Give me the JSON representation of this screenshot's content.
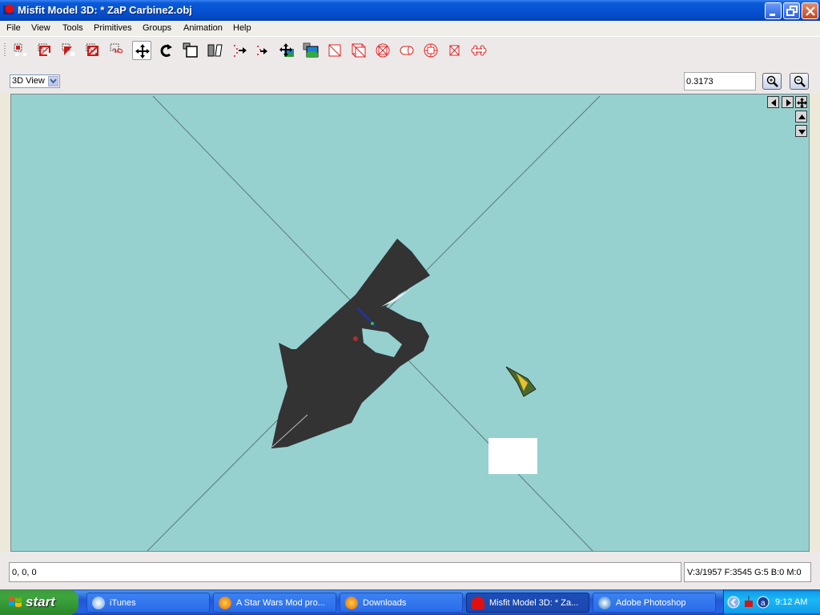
{
  "window": {
    "title": "Misfit Model 3D: * ZaP Carbine2.obj",
    "controls": [
      "minimize",
      "restore",
      "close"
    ]
  },
  "menu": {
    "items": [
      "File",
      "View",
      "Tools",
      "Primitives",
      "Groups",
      "Animation",
      "Help"
    ]
  },
  "toolbar": {
    "tools": [
      {
        "name": "select-vertices-tool",
        "icon": "select-vertices-icon"
      },
      {
        "name": "select-faces-tool",
        "icon": "select-faces-icon"
      },
      {
        "name": "select-connected-tool",
        "icon": "select-connected-icon"
      },
      {
        "name": "select-groups-tool",
        "icon": "select-groups-icon"
      },
      {
        "name": "select-bones-tool",
        "icon": "select-bones-icon"
      },
      {
        "name": "move-tool",
        "icon": "move-icon",
        "active": true
      },
      {
        "name": "rotate-tool",
        "icon": "rotate-icon"
      },
      {
        "name": "scale-tool",
        "icon": "scale-icon"
      },
      {
        "name": "shear-tool",
        "icon": "shear-icon"
      },
      {
        "name": "extrude-tool",
        "icon": "extrude-icon"
      },
      {
        "name": "attract-near-tool",
        "icon": "attract-icon"
      },
      {
        "name": "drag-vertex-tool",
        "icon": "drag-vertex-icon"
      },
      {
        "name": "background-image-tool",
        "icon": "background-image-icon"
      },
      {
        "name": "create-rectangle-tool",
        "icon": "rectangle-icon"
      },
      {
        "name": "create-cube-tool",
        "icon": "cube-icon"
      },
      {
        "name": "create-ellipsoid-tool",
        "icon": "ellipsoid-icon"
      },
      {
        "name": "create-cylinder-tool",
        "icon": "cylinder-icon"
      },
      {
        "name": "create-torus-tool",
        "icon": "torus-icon"
      },
      {
        "name": "create-polygon-tool",
        "icon": "polygon-icon"
      },
      {
        "name": "create-bone-tool",
        "icon": "bone-icon"
      }
    ]
  },
  "view": {
    "selected_view": "3D View",
    "zoom_value": "0.3173",
    "zoom_in_label": "Zoom in",
    "zoom_out_label": "Zoom out"
  },
  "nav": {
    "buttons": [
      "pan-left",
      "pan-right",
      "pan-move",
      "pan-up",
      "pan-down"
    ]
  },
  "status": {
    "coordinates": "0, 0, 0",
    "stats": "V:3/1957 F:3545 G:5 B:0 M:0"
  },
  "colors": {
    "viewport_bg": "#96d1d0",
    "model_color": "#333333",
    "tool_red": "#e02020"
  },
  "taskbar": {
    "start_label": "start",
    "tasks": [
      {
        "label": "iTunes",
        "icon": "itunes-icon"
      },
      {
        "label": "A Star Wars Mod pro...",
        "icon": "firefox-icon"
      },
      {
        "label": "Downloads",
        "icon": "firefox-icon"
      },
      {
        "label": "Misfit Model 3D: * Za...",
        "icon": "misfit-icon",
        "active": true
      },
      {
        "label": "Adobe Photoshop",
        "icon": "photoshop-icon"
      }
    ],
    "clock": "9:12 AM"
  }
}
